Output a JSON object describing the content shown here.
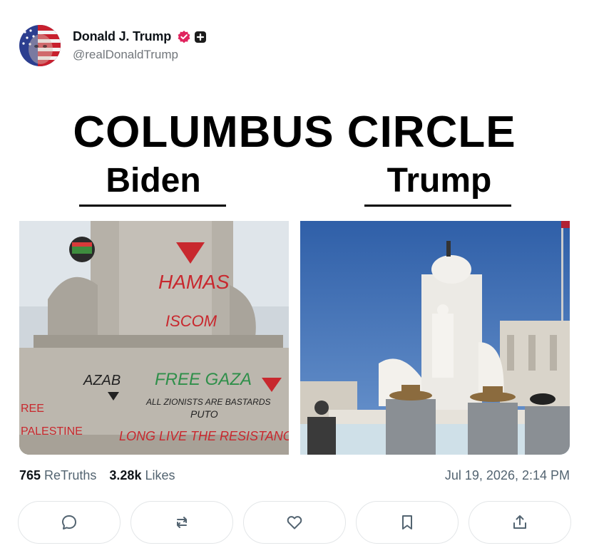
{
  "post": {
    "author": {
      "display_name": "Donald J. Trump",
      "handle": "@realDonaldTrump",
      "avatar_icon": "avatar-flag-face",
      "verified_icon": "verified-badge-icon",
      "verified_color": "#e0245e",
      "plus_icon": "plus-badge-icon"
    },
    "image": {
      "headline": "COLUMBUS CIRCLE",
      "left_label": "Biden",
      "right_label": "Trump",
      "left_graffiti": [
        "HAMAS",
        "ISCOM",
        "FREE GAZA",
        "ALL ZIONISTS ARE BASTARDS",
        "PUTO",
        "AZAB",
        "LONG LIVE THE RESISTANCE",
        "REE",
        "PALESTINE"
      ]
    },
    "stats": {
      "retruths_count": "765",
      "retruths_label": "ReTruths",
      "likes_count": "3.28k",
      "likes_label": "Likes",
      "timestamp": "Jul 19, 2026, 2:14 PM"
    },
    "actions": {
      "reply_icon": "reply-icon",
      "retruth_icon": "retruth-icon",
      "like_icon": "heart-icon",
      "bookmark_icon": "bookmark-icon",
      "share_icon": "share-icon"
    }
  }
}
